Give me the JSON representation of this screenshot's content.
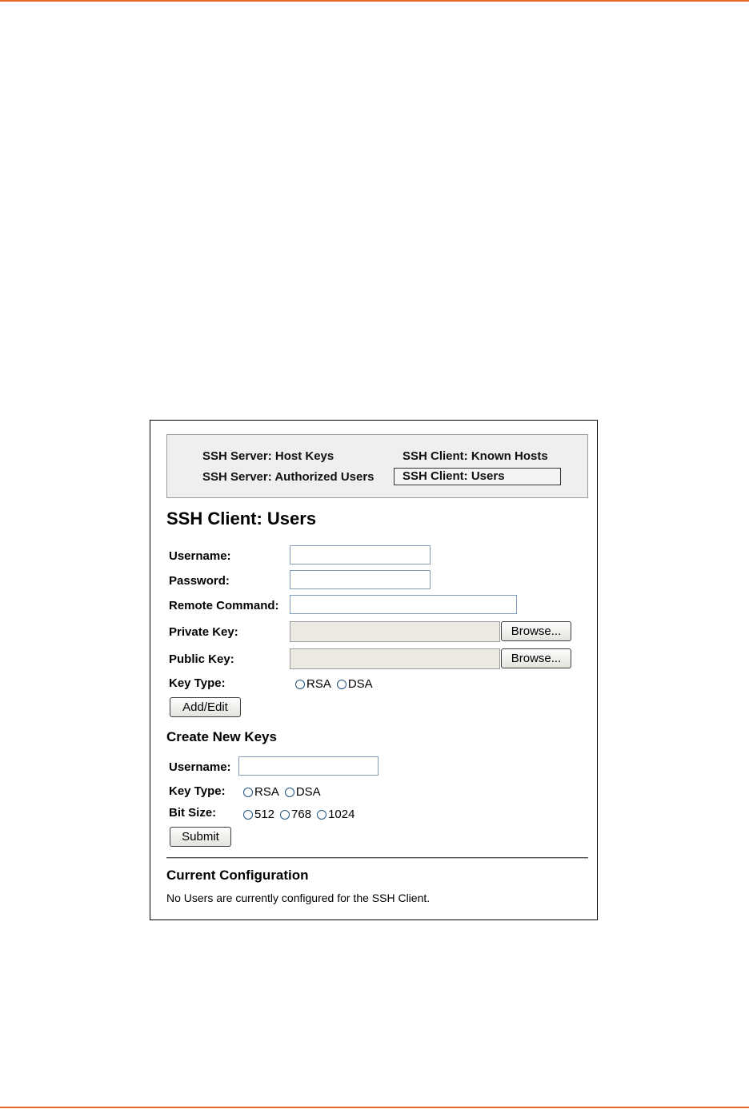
{
  "nav": {
    "host_keys": "SSH Server: Host Keys",
    "authorized_users": "SSH Server: Authorized Users",
    "known_hosts": "SSH Client: Known Hosts",
    "users": "SSH Client: Users"
  },
  "page_title": "SSH Client: Users",
  "form": {
    "username_label": "Username:",
    "username_value": "",
    "password_label": "Password:",
    "password_value": "",
    "remote_command_label": "Remote Command:",
    "remote_command_value": "",
    "private_key_label": "Private Key:",
    "public_key_label": "Public Key:",
    "browse_label": "Browse...",
    "key_type_label": "Key Type:",
    "key_type_options": [
      "RSA",
      "DSA"
    ],
    "add_edit_label": "Add/Edit"
  },
  "create_keys": {
    "title": "Create New Keys",
    "username_label": "Username:",
    "username_value": "",
    "key_type_label": "Key Type:",
    "key_type_options": [
      "RSA",
      "DSA"
    ],
    "bit_size_label": "Bit Size:",
    "bit_size_options": [
      "512",
      "768",
      "1024"
    ],
    "submit_label": "Submit"
  },
  "current_config": {
    "title": "Current Configuration",
    "message": "No Users are currently configured for the SSH Client."
  },
  "colors": {
    "accent_rule": "#e8682a",
    "nav_background": "#efefef",
    "input_border": "#7f9db9",
    "radio_border": "#1c5180"
  }
}
